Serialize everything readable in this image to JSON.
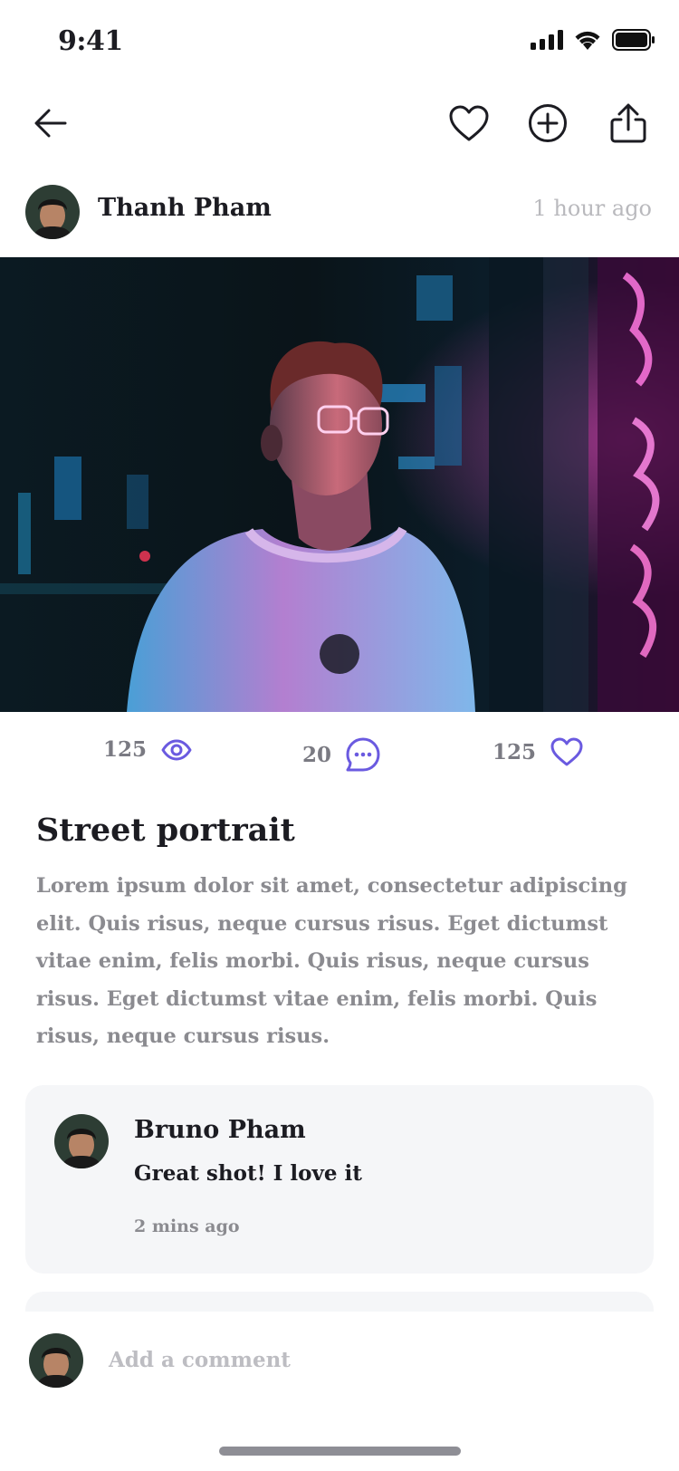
{
  "status_bar": {
    "time": "9:41"
  },
  "nav": {
    "back_icon": "arrow-left-icon",
    "like_icon": "heart-icon",
    "add_icon": "plus-circle-icon",
    "share_icon": "share-icon"
  },
  "post": {
    "author": "Thanh Pham",
    "time": "1 hour ago",
    "stats": {
      "views": "125",
      "comments": "20",
      "likes": "125"
    },
    "title": "Street portrait",
    "body": "Lorem ipsum dolor sit amet, consectetur adipiscing elit. Quis risus, neque cursus risus. Eget dictumst vitae enim, felis morbi. Quis risus, neque cursus risus. Eget dictumst vitae enim, felis morbi. Quis risus, neque cursus risus."
  },
  "comments": [
    {
      "name": "Bruno Pham",
      "text": "Great shot! I love it",
      "time": "2 mins ago"
    }
  ],
  "composer": {
    "placeholder": "Add a comment"
  },
  "colors": {
    "accent": "#6a5ae0",
    "muted": "#8b8b90",
    "card": "#f5f6f8"
  }
}
